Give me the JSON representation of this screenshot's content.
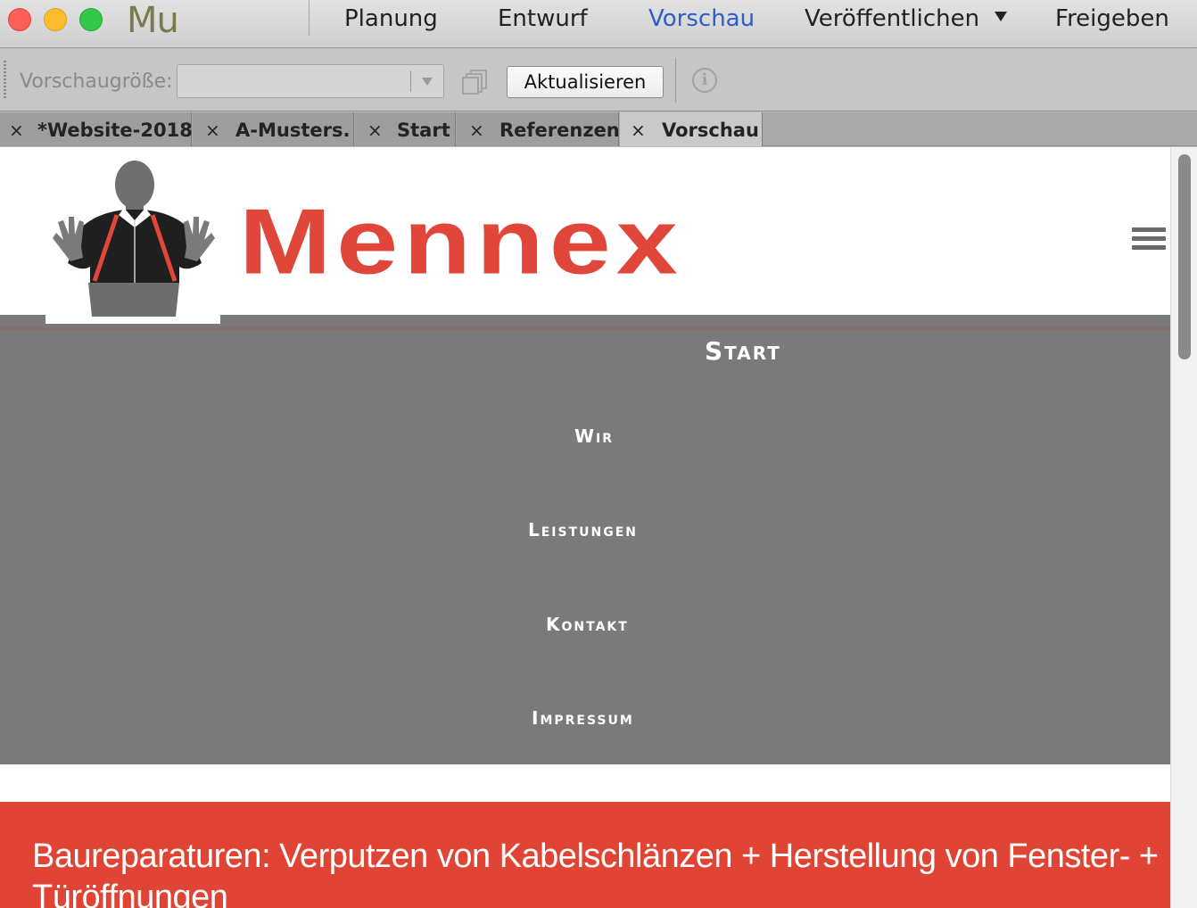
{
  "app": {
    "logo": "Mu"
  },
  "workspace_tabs": [
    {
      "label": "Planung",
      "active": false
    },
    {
      "label": "Entwurf",
      "active": false
    },
    {
      "label": "Vorschau",
      "active": true
    },
    {
      "label": "Veröffentlichen",
      "active": false,
      "has_dropdown": true
    },
    {
      "label": "Freigeben",
      "active": false
    }
  ],
  "controlbar": {
    "size_label": "Vorschaugröße:",
    "size_value": "",
    "refresh_label": "Aktualisieren",
    "info_icon": "info-icon",
    "info_glyph": "i"
  },
  "doc_tabs": [
    {
      "label": "*Website-2018",
      "active": false
    },
    {
      "label": "A-Musters.",
      "active": false
    },
    {
      "label": "Start",
      "active": false
    },
    {
      "label": "Referenzen",
      "active": false
    },
    {
      "label": "Vorschau",
      "active": true
    }
  ],
  "doc_tab_close_glyph": "×",
  "site": {
    "brand": "Mennex",
    "brand_color": "#e0473a",
    "menu": {
      "start": "Start",
      "items": [
        "Wir",
        "Leistungen",
        "Kontakt",
        "Impressum"
      ]
    },
    "banner_text": "Baureparaturen: Verputzen von Kabelschlänzen + Herstellung von Fenster- + Türöffnungen",
    "banner_color": "#e04435"
  },
  "colors": {
    "active_workspace_tab": "#2e5ec9",
    "menu_background": "#7a7a7a"
  }
}
